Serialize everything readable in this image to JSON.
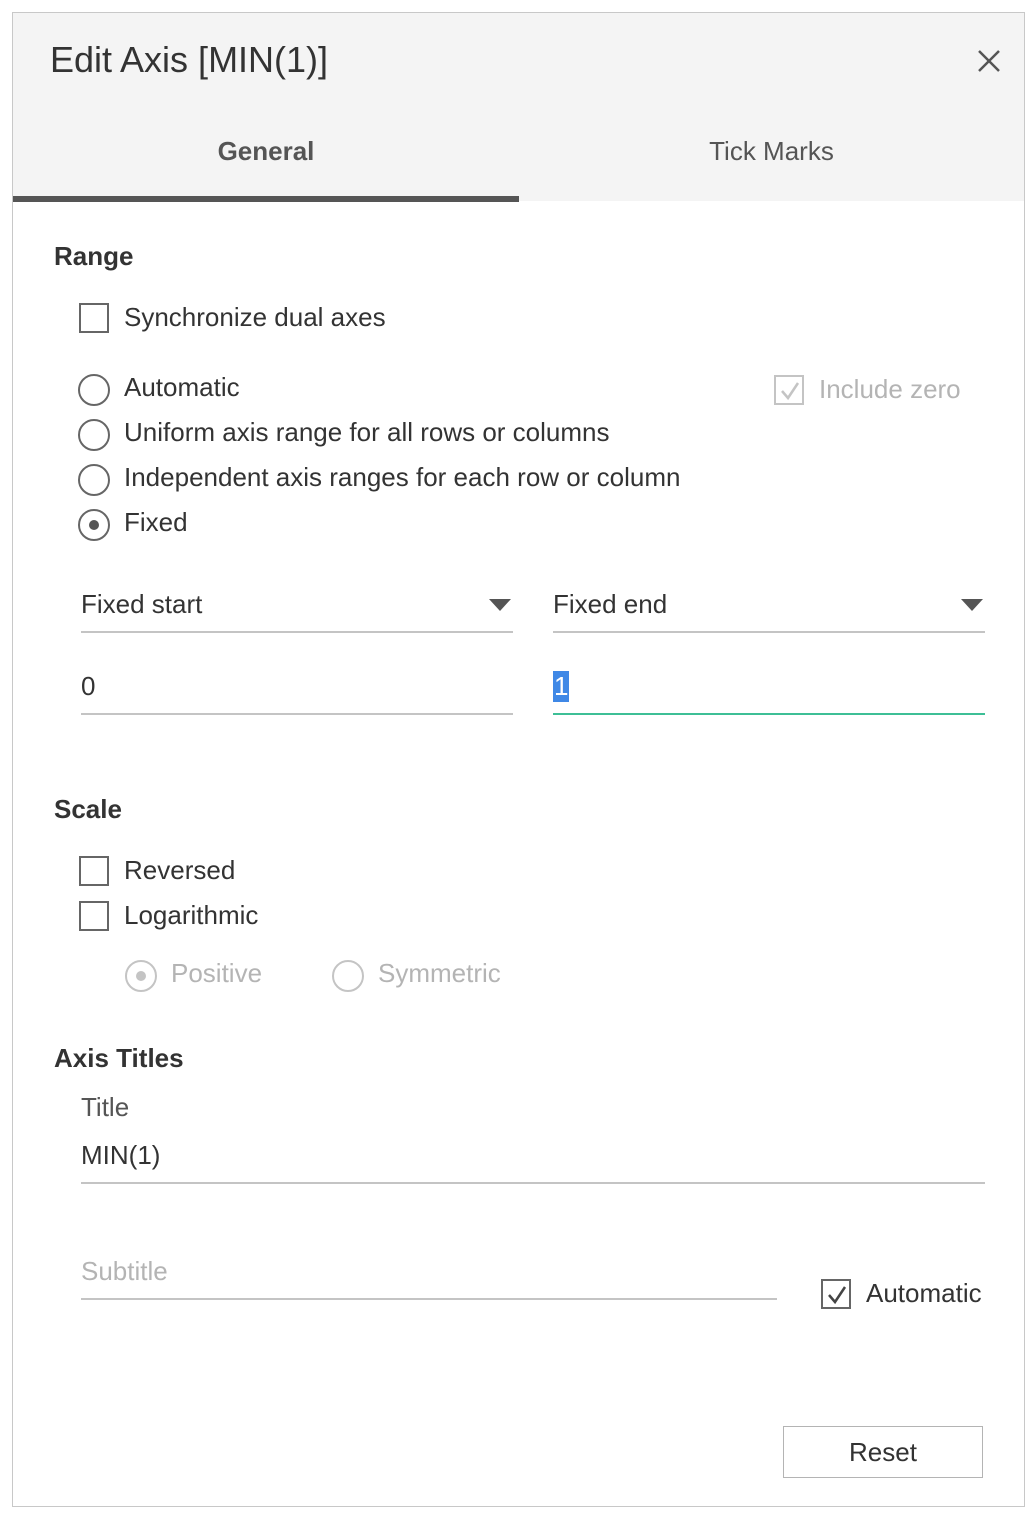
{
  "dialog": {
    "title": "Edit Axis [MIN(1)]",
    "close_icon": "close-icon"
  },
  "tabs": [
    {
      "label": "General",
      "active": true
    },
    {
      "label": "Tick Marks",
      "active": false
    }
  ],
  "range": {
    "heading": "Range",
    "synchronize_label": "Synchronize dual axes",
    "synchronize_checked": false,
    "include_zero_label": "Include zero",
    "include_zero_checked": true,
    "include_zero_disabled": true,
    "options": [
      {
        "label": "Automatic",
        "selected": false
      },
      {
        "label": "Uniform axis range for all rows or columns",
        "selected": false
      },
      {
        "label": "Independent axis ranges for each row or column",
        "selected": false
      },
      {
        "label": "Fixed",
        "selected": true
      }
    ],
    "start_mode": "Fixed start",
    "end_mode": "Fixed end",
    "start_value": "0",
    "end_value": "1"
  },
  "scale": {
    "heading": "Scale",
    "reversed_label": "Reversed",
    "reversed_checked": false,
    "logarithmic_label": "Logarithmic",
    "logarithmic_checked": false,
    "log_options": [
      {
        "label": "Positive",
        "selected": true,
        "disabled": true
      },
      {
        "label": "Symmetric",
        "selected": false,
        "disabled": true
      }
    ]
  },
  "axis_titles": {
    "heading": "Axis Titles",
    "title_label": "Title",
    "title_value": "MIN(1)",
    "subtitle_placeholder": "Subtitle",
    "automatic_label": "Automatic",
    "automatic_checked": true
  },
  "buttons": {
    "reset_label": "Reset"
  },
  "colors": {
    "focus_underline": "#3dbf96",
    "selection": "#3f88e6",
    "tab_indicator": "#555555"
  }
}
